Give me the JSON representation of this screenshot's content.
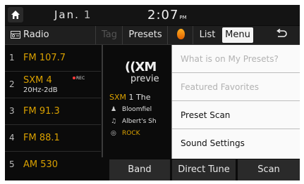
{
  "status": {
    "date": "Jan.",
    "day": "1",
    "time": "2:07",
    "ampm": "PM"
  },
  "topbar": {
    "radio": "Radio",
    "tag": "Tag",
    "presets": "Presets",
    "list": "List",
    "menu": "Menu"
  },
  "presets": [
    {
      "num": "1",
      "name": "FM 107.7"
    },
    {
      "num": "2",
      "name": "SXM 4",
      "sub": "20Hz-2dB",
      "rec": "REC"
    },
    {
      "num": "3",
      "name": "FM 91.3"
    },
    {
      "num": "4",
      "name": "FM 88.1"
    },
    {
      "num": "5",
      "name": "AM 530"
    }
  ],
  "nowplaying": {
    "logo": "((XM",
    "logo_sub": "previe",
    "sxm": "SXM",
    "channel": "1  The",
    "artist": "Bloomfiel",
    "song": "Albert's Sh",
    "genre": "ROCK"
  },
  "bottom": {
    "band": "Band",
    "direct_tune": "Direct Tune",
    "scan": "Scan"
  },
  "menu_items": [
    {
      "label": "What is on My Presets?"
    },
    {
      "label": "Featured Favorites"
    },
    {
      "label": "Preset Scan"
    },
    {
      "label": "Sound Settings"
    }
  ],
  "colors": {
    "accent": "#d9a000",
    "menu_bg": "#fafafa",
    "screen_bg": "#0b0b0b"
  }
}
